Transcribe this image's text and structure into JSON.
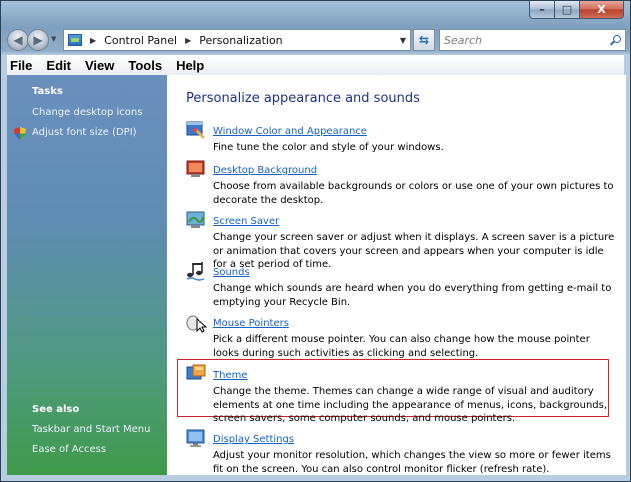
{
  "window": {
    "caption": {
      "minimize": "–",
      "maximize": "□",
      "close": "X"
    }
  },
  "address_bar": {
    "crumbs": [
      "Control Panel",
      "Personalization"
    ]
  },
  "search": {
    "placeholder": "Search"
  },
  "menu": [
    "File",
    "Edit",
    "View",
    "Tools",
    "Help"
  ],
  "left_pane": {
    "tasks_heading": "Tasks",
    "tasks": [
      "Change desktop icons",
      "Adjust font size (DPI)"
    ],
    "see_also_heading": "See also",
    "see_also": [
      "Taskbar and Start Menu",
      "Ease of Access"
    ]
  },
  "main": {
    "title": "Personalize appearance and sounds",
    "items": [
      {
        "title": "Window Color and Appearance",
        "desc": "Fine tune the color and style of your windows.",
        "icon": "window-color-icon"
      },
      {
        "title": "Desktop Background",
        "desc": "Choose from available backgrounds or colors or use one of your own pictures to decorate the desktop.",
        "icon": "desktop-background-icon"
      },
      {
        "title": "Screen Saver",
        "desc": "Change your screen saver or adjust when it displays. A screen saver is a picture or animation that covers your screen and appears when your computer is idle for a set period of time.",
        "icon": "screen-saver-icon"
      },
      {
        "title": "Sounds",
        "desc": "Change which sounds are heard when you do everything from getting e-mail to emptying your Recycle Bin.",
        "icon": "sounds-icon"
      },
      {
        "title": "Mouse Pointers",
        "desc": "Pick a different mouse pointer. You can also change how the mouse pointer looks during such activities as clicking and selecting.",
        "icon": "mouse-pointer-icon"
      },
      {
        "title": "Theme",
        "desc": "Change the theme. Themes can change a wide range of visual and auditory elements at one time including the appearance of menus, icons, backgrounds, screen savers, some computer sounds, and mouse pointers.",
        "icon": "theme-icon"
      },
      {
        "title": "Display Settings",
        "desc": "Adjust your monitor resolution, which changes the view so more or fewer items fit on the screen. You can also control monitor flicker (refresh rate).",
        "icon": "display-settings-icon"
      }
    ]
  },
  "colors": {
    "link": "#1562c4",
    "heading": "#1e3287",
    "highlight_border": "#d2232a"
  }
}
